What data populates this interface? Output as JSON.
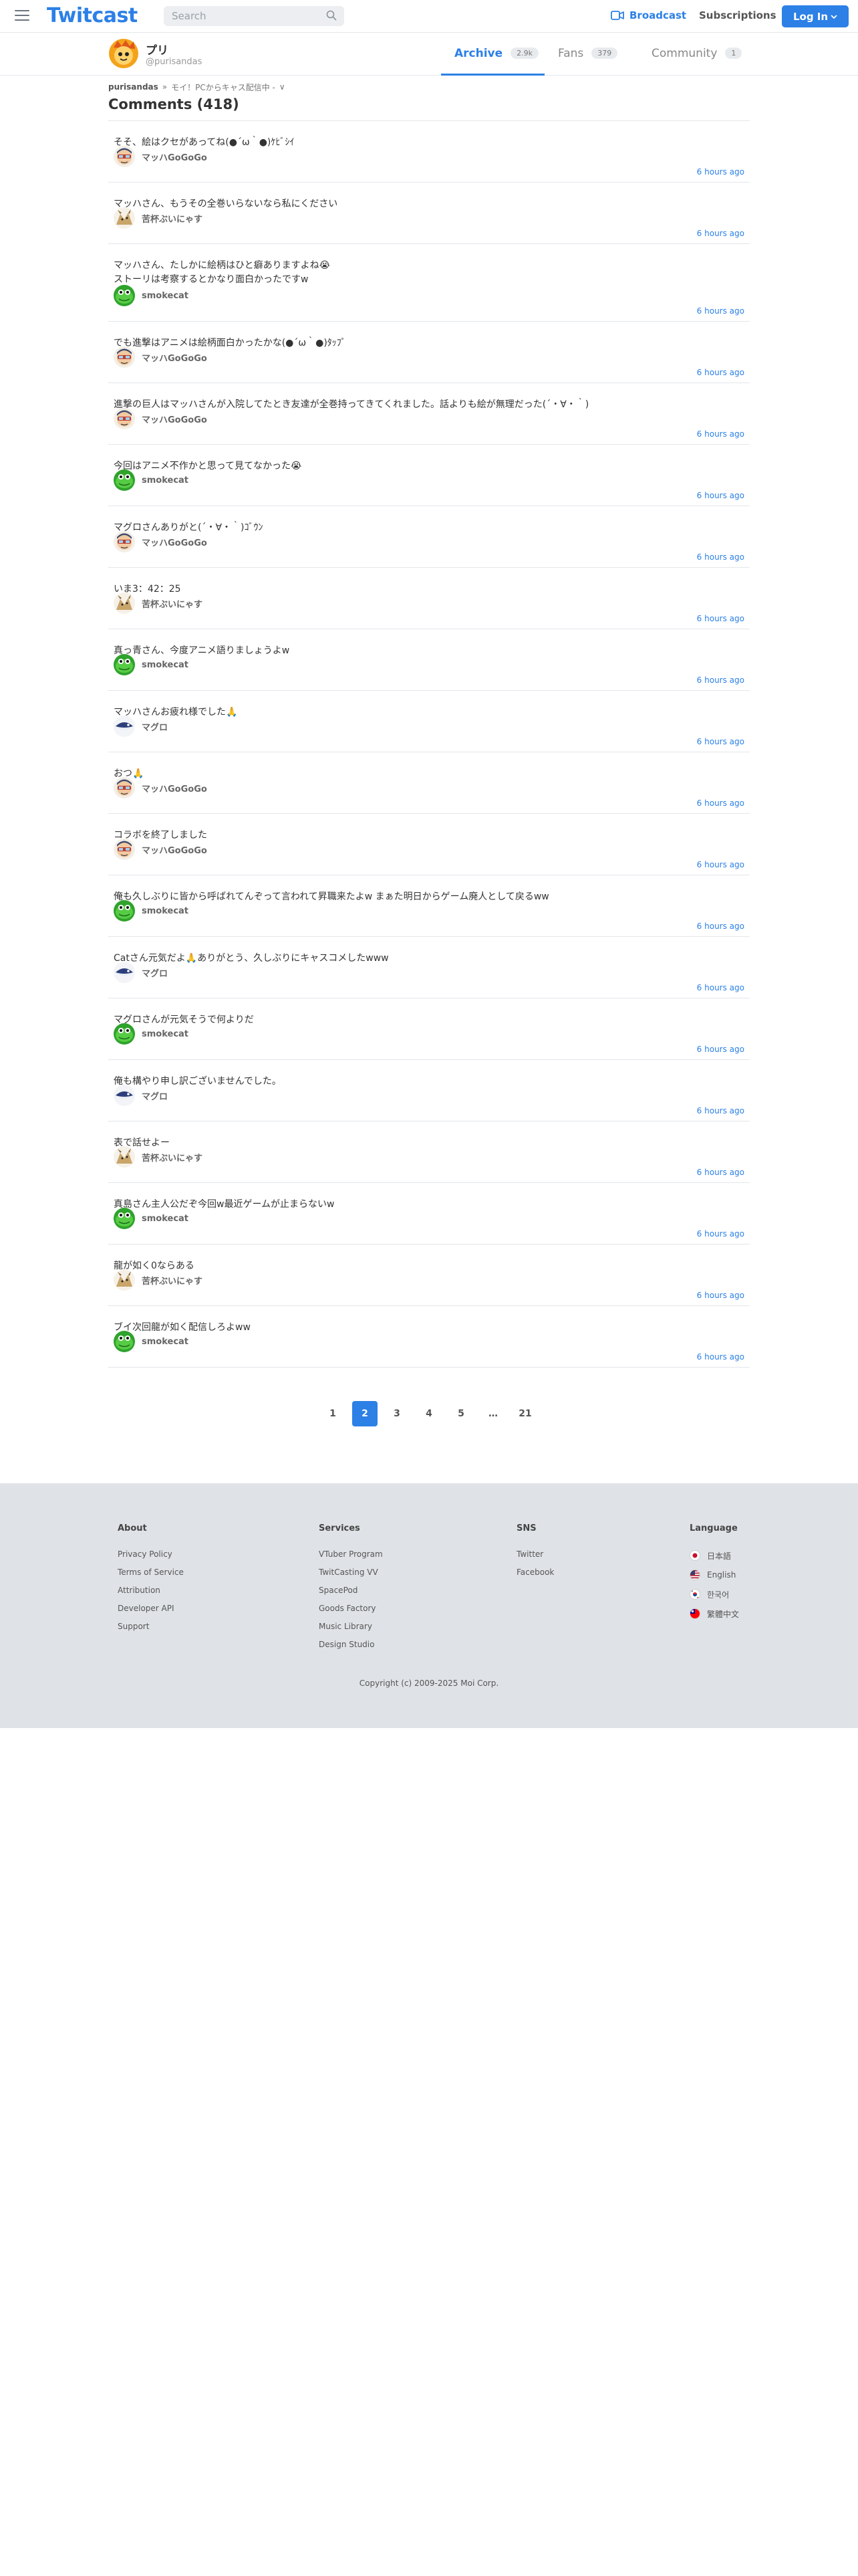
{
  "header": {
    "logo": "Twitcast",
    "search_placeholder": "Search",
    "broadcast_label": "Broadcast",
    "subscriptions_label": "Subscriptions",
    "login_label": "Log In"
  },
  "user": {
    "name": "プリ",
    "handle": "@purisandas"
  },
  "tabs": [
    {
      "label": "Archive",
      "count": "2.9k"
    },
    {
      "label": "Fans",
      "count": "379"
    },
    {
      "label": "Community",
      "count": "1"
    }
  ],
  "breadcrumb": {
    "user": "purisandas",
    "separator": "»",
    "live_title": "モイ！PCからキャス配信中 -",
    "chevron": "∨"
  },
  "page_title": "Comments (418)",
  "comments": [
    {
      "text": "そそ、絵はクセがあってね(●´ω｀●)ｹﾋﾞｼｲ",
      "author": "マッハGoGoGo",
      "avatar": "mach",
      "time": "6 hours ago"
    },
    {
      "text": "マッハさん、もうその全巻いらないなら私にください",
      "author": "苦杯ぶいにゃす",
      "avatar": "nyasu",
      "time": "6 hours ago"
    },
    {
      "text": "マッハさん、たしかに絵柄はひと癖ありますよね😭\nストーリは考察するとかなり面白かったですw",
      "author": "smokecat",
      "avatar": "smoke",
      "time": "6 hours ago"
    },
    {
      "text": "でも進撃はアニメは絵柄面白かったかな(●´ω｀●)ﾀｯﾌﾟ",
      "author": "マッハGoGoGo",
      "avatar": "mach",
      "time": "6 hours ago"
    },
    {
      "text": "進撃の巨人はマッハさんが入院してたとき友達が全巻持ってきてくれました。話よりも絵が無理だった(´・∀・｀)",
      "author": "マッハGoGoGo",
      "avatar": "mach",
      "time": "6 hours ago"
    },
    {
      "text": "今回はアニメ不作かと思って見てなかった😭",
      "author": "smokecat",
      "avatar": "smoke",
      "time": "6 hours ago"
    },
    {
      "text": "マグロさんありがと(´・∀・｀)ｺﾞｳﾝ",
      "author": "マッハGoGoGo",
      "avatar": "mach",
      "time": "6 hours ago"
    },
    {
      "text": "いま3：42：25",
      "author": "苦杯ぶいにゃす",
      "avatar": "nyasu",
      "time": "6 hours ago"
    },
    {
      "text": "真っ青さん、今度アニメ語りましょうよw",
      "author": "smokecat",
      "avatar": "smoke",
      "time": "6 hours ago"
    },
    {
      "text": "マッハさんお疲れ様でした🙏",
      "author": "マグロ",
      "avatar": "maguro",
      "time": "6 hours ago"
    },
    {
      "text": "おつ🙏",
      "author": "マッハGoGoGo",
      "avatar": "mach",
      "time": "6 hours ago"
    },
    {
      "text": "コラボを終了しました",
      "author": "マッハGoGoGo",
      "avatar": "mach",
      "time": "6 hours ago"
    },
    {
      "text": "俺も久しぶりに皆から呼ばれてんぞって言われて昇職来たよw まぁた明日からゲーム廃人として戻るww",
      "author": "smokecat",
      "avatar": "smoke",
      "time": "6 hours ago"
    },
    {
      "text": "Catさん元気だよ🙏ありがとう、久しぶりにキャスコメしたwww",
      "author": "マグロ",
      "avatar": "maguro",
      "time": "6 hours ago"
    },
    {
      "text": "マグロさんが元気そうで何よりだ",
      "author": "smokecat",
      "avatar": "smoke",
      "time": "6 hours ago"
    },
    {
      "text": "俺も構やり申し訳ございませんでした。",
      "author": "マグロ",
      "avatar": "maguro",
      "time": "6 hours ago"
    },
    {
      "text": "表で話せよー",
      "author": "苦杯ぶいにゃす",
      "avatar": "nyasu",
      "time": "6 hours ago"
    },
    {
      "text": "真島さん主人公だぞ今回w最近ゲームが止まらないw",
      "author": "smokecat",
      "avatar": "smoke",
      "time": "6 hours ago"
    },
    {
      "text": "龍が如く0ならある",
      "author": "苦杯ぶいにゃす",
      "avatar": "nyasu",
      "time": "6 hours ago"
    },
    {
      "text": "ブイ次回龍が如く配信しろよww",
      "author": "smokecat",
      "avatar": "smoke",
      "time": "6 hours ago"
    }
  ],
  "pagination": {
    "pages": [
      "1",
      "2",
      "3",
      "4",
      "5",
      "…",
      "21"
    ],
    "current": "2"
  },
  "footer": {
    "about": {
      "title": "About",
      "links": [
        "Privacy Policy",
        "Terms of Service",
        "Attribution",
        "Developer API",
        "Support"
      ]
    },
    "services": {
      "title": "Services",
      "links": [
        "VTuber Program",
        "TwitCasting VV",
        "SpacePod",
        "Goods Factory",
        "Music Library",
        "Design Studio"
      ]
    },
    "sns": {
      "title": "SNS",
      "links": [
        "Twitter",
        "Facebook"
      ]
    },
    "language": {
      "title": "Language",
      "items": [
        {
          "label": "日本語",
          "flag": "jp"
        },
        {
          "label": "English",
          "flag": "us"
        },
        {
          "label": "한국어",
          "flag": "kr"
        },
        {
          "label": "繁體中文",
          "flag": "tw"
        }
      ]
    },
    "copyright": "Copyright (c) 2009-2025 Moi Corp."
  },
  "colors": {
    "accent": "#2c80e6",
    "footer_bg": "#dfe2e6",
    "divider": "#e3e6ea"
  }
}
